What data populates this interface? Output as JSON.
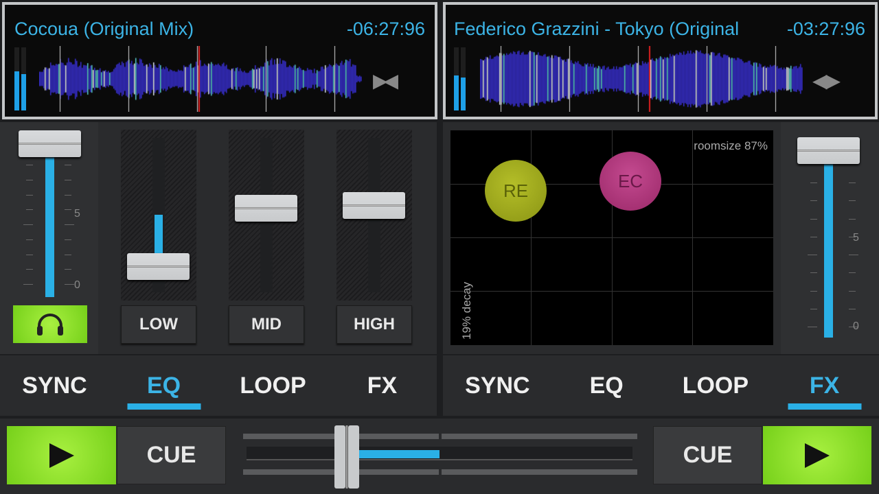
{
  "deck_a": {
    "title": "Cocoua (Original Mix)",
    "time": "-06:27:96",
    "sync_icon": "arrows-converge-icon",
    "volume": 1.0,
    "eq": {
      "low": 0.1,
      "mid": 0.55,
      "high": 0.57
    },
    "eq_labels": [
      "LOW",
      "MID",
      "HIGH"
    ],
    "scale_labels": [
      "5",
      "0"
    ],
    "headphone_icon": "headphones-icon",
    "tabs": [
      "SYNC",
      "EQ",
      "LOOP",
      "FX"
    ],
    "active_tab": "EQ",
    "cue_label": "CUE",
    "play_icon": "play-icon"
  },
  "deck_b": {
    "title": "Federico Grazzini - Tokyo (Original",
    "time": "-03:27:96",
    "sync_icon": "arrows-diverge-icon",
    "volume": 0.97,
    "scale_labels": [
      "5",
      "0"
    ],
    "fx_pad": {
      "x_label": "roomsize 87%",
      "y_label": "19% decay",
      "balls": [
        "RE",
        "EC"
      ]
    },
    "tabs": [
      "SYNC",
      "EQ",
      "LOOP",
      "FX"
    ],
    "active_tab": "FX",
    "cue_label": "CUE",
    "play_icon": "play-icon"
  },
  "crossfader": {
    "position": 0.24
  },
  "colors": {
    "accent": "#2ab0e6",
    "play": "#8ee02a",
    "re": "#9aa51a",
    "ec": "#b0307a"
  }
}
